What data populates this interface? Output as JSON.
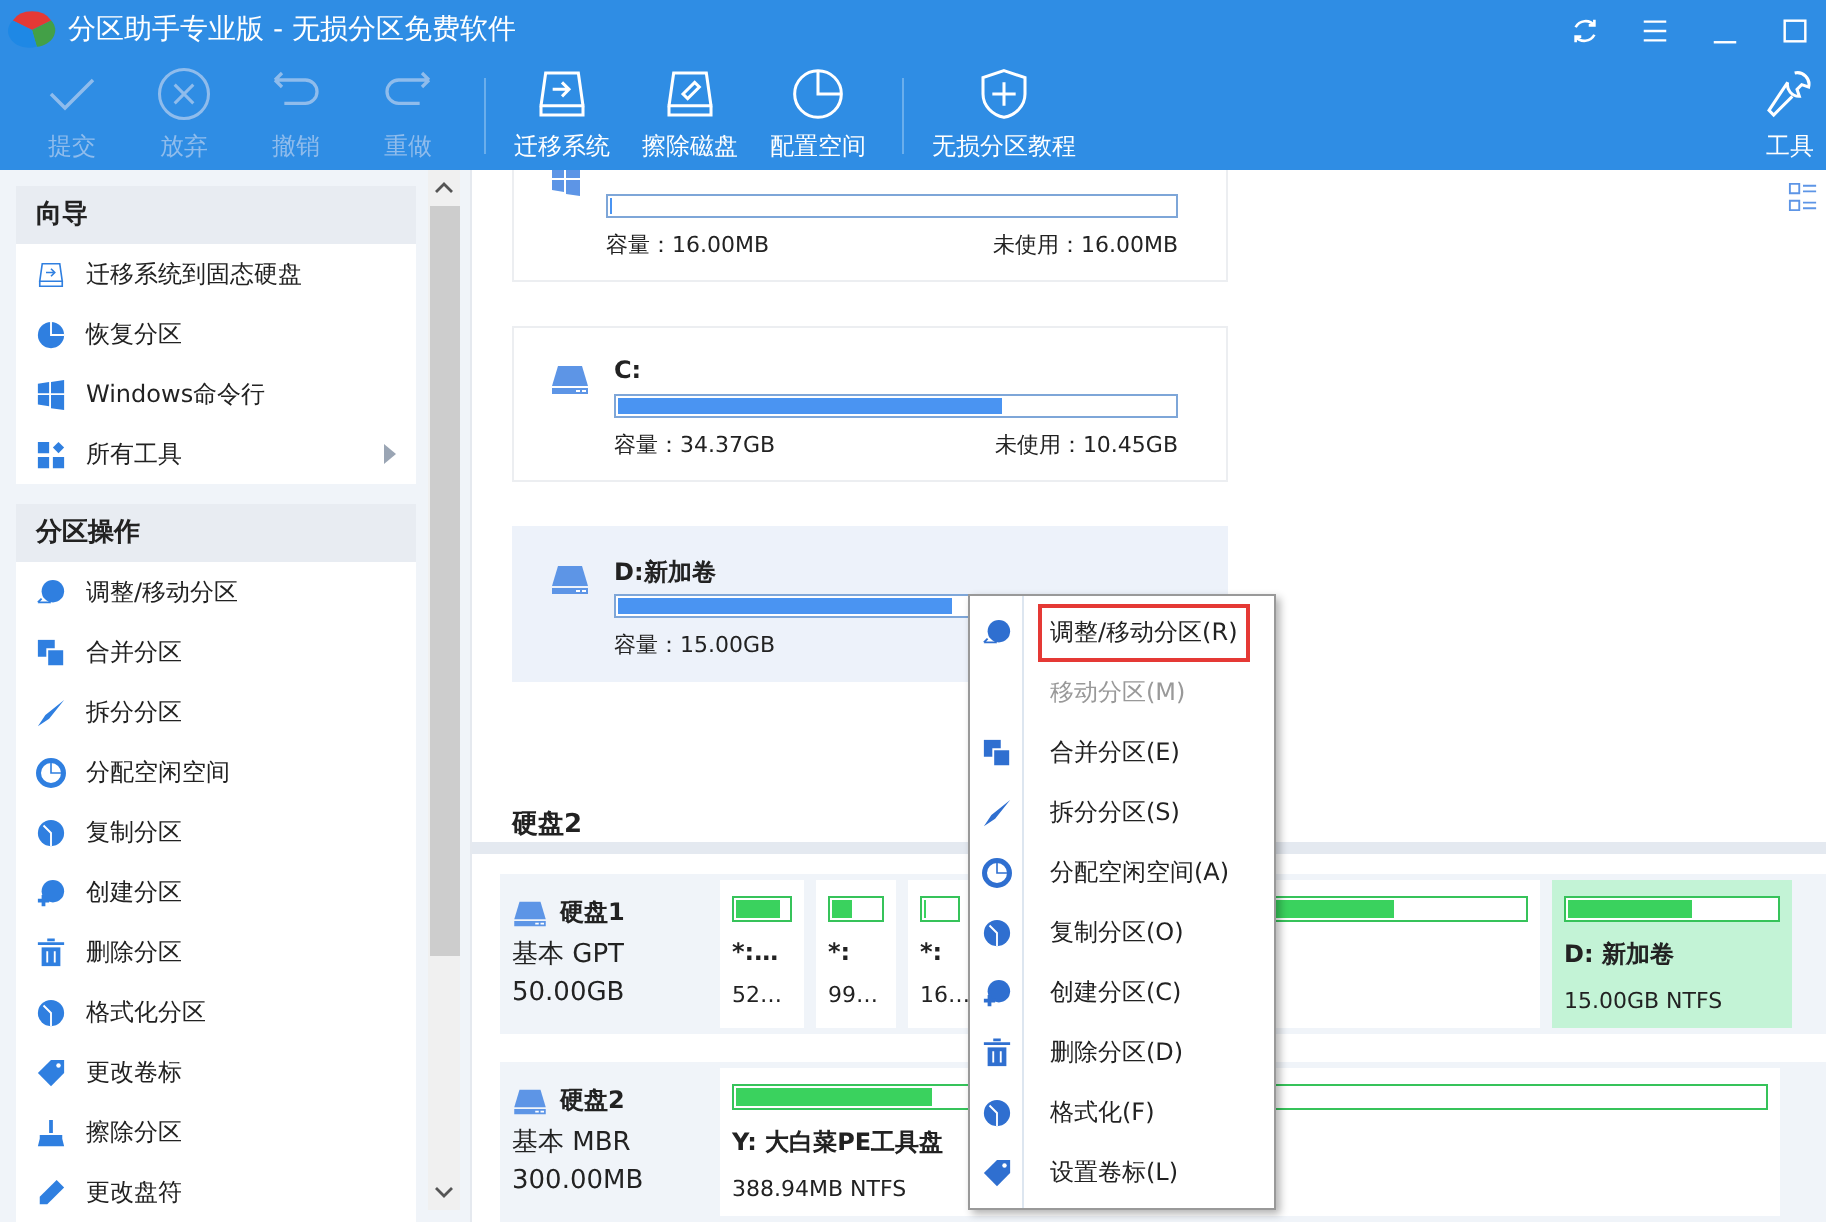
{
  "window": {
    "title": "分区助手专业版 - 无损分区免费软件"
  },
  "toolbar": [
    {
      "label": "提交",
      "disabled": true
    },
    {
      "label": "放弃",
      "disabled": true
    },
    {
      "label": "撤销",
      "disabled": true
    },
    {
      "label": "重做",
      "disabled": true
    },
    {
      "label": "迁移系统",
      "disabled": false
    },
    {
      "label": "擦除磁盘",
      "disabled": false
    },
    {
      "label": "配置空间",
      "disabled": false
    },
    {
      "label": "无损分区教程",
      "disabled": false
    },
    {
      "label": "工具",
      "disabled": false
    }
  ],
  "sidebar": [
    {
      "title": "向导",
      "items": [
        {
          "label": "迁移系统到固态硬盘",
          "submenu": false
        },
        {
          "label": "恢复分区",
          "submenu": false
        },
        {
          "label": "Windows命令行",
          "submenu": false
        },
        {
          "label": "所有工具",
          "submenu": true
        }
      ]
    },
    {
      "title": "分区操作",
      "items": [
        {
          "label": "调整/移动分区",
          "submenu": false
        },
        {
          "label": "合并分区",
          "submenu": false
        },
        {
          "label": "拆分分区",
          "submenu": false
        },
        {
          "label": "分配空闲空间",
          "submenu": false
        },
        {
          "label": "复制分区",
          "submenu": false
        },
        {
          "label": "创建分区",
          "submenu": false
        },
        {
          "label": "删除分区",
          "submenu": false
        },
        {
          "label": "格式化分区",
          "submenu": false
        },
        {
          "label": "更改卷标",
          "submenu": false
        },
        {
          "label": "擦除分区",
          "submenu": false
        },
        {
          "label": "更改盘符",
          "submenu": false
        }
      ]
    }
  ],
  "partitions": [
    {
      "level": 0,
      "capacity": "容量：16.00MB",
      "unused": "未使用：16.00MB",
      "selected": false
    },
    {
      "name": "C:",
      "level": 0.69,
      "capacity": "容量：34.37GB",
      "unused": "未使用：10.45GB",
      "selected": false
    },
    {
      "name": "D:新加卷",
      "level": 0.6,
      "capacity": "容量：15.00GB",
      "selected": true
    }
  ],
  "section_heading": "硬盘2",
  "disks": [
    {
      "name": "硬盘1",
      "type": "基本 GPT",
      "size": "50.00GB",
      "partitions": [
        {
          "name": "*:…",
          "info": "52…",
          "level": 0.85,
          "selected": false
        },
        {
          "name": "*:",
          "info": "99…",
          "level": 0.4,
          "selected": false
        },
        {
          "name": "*:",
          "info": "16…",
          "level": 0,
          "selected": false
        },
        {
          "level": 0.75,
          "selected": false
        },
        {
          "name": "D: 新加卷",
          "info": "15.00GB NTFS",
          "level": 0.6,
          "selected": true
        }
      ]
    },
    {
      "name": "硬盘2",
      "type": "基本 MBR",
      "size": "300.00MB",
      "partitions": [
        {
          "name": "Y: 大白菜PE工具盘",
          "info": "388.94MB NTFS",
          "level": 0.19,
          "selected": false
        }
      ]
    }
  ],
  "context_menu": [
    {
      "label": "调整/移动分区(R)",
      "disabled": false,
      "selected": true
    },
    {
      "label": "移动分区(M)",
      "disabled": true,
      "selected": false
    },
    {
      "label": "合并分区(E)",
      "disabled": false,
      "selected": false
    },
    {
      "label": "拆分分区(S)",
      "disabled": false,
      "selected": false
    },
    {
      "label": "分配空闲空间(A)",
      "disabled": false,
      "selected": false
    },
    {
      "label": "复制分区(O)",
      "disabled": false,
      "selected": false
    },
    {
      "label": "创建分区(C)",
      "disabled": false,
      "selected": false
    },
    {
      "label": "删除分区(D)",
      "disabled": false,
      "selected": false
    },
    {
      "label": "格式化(F)",
      "disabled": false,
      "selected": false
    },
    {
      "label": "设置卷标(L)",
      "disabled": false,
      "selected": false
    }
  ]
}
